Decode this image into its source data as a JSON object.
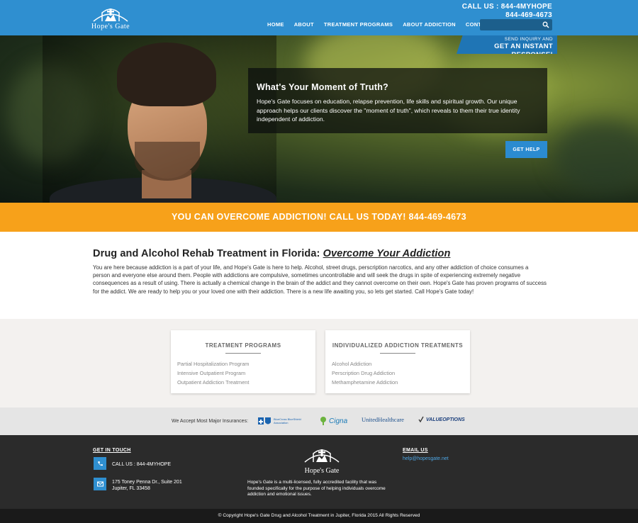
{
  "header": {
    "logo_text": "Hope's Gate",
    "call_line1": "CALL US : 844-4MYHOPE",
    "call_line2": "844-469-4673",
    "nav": [
      "HOME",
      "ABOUT",
      "TREATMENT PROGRAMS",
      "ABOUT ADDICTION",
      "CONTACT"
    ],
    "search_placeholder": "",
    "colors": {
      "brand_blue": "#2f8fd0",
      "orange": "#f7a11a"
    }
  },
  "hero": {
    "inquiry_small": "SEND INQUIRY AND",
    "inquiry_big": "GET AN INSTANT RESPONSE!",
    "box_title": "What's Your Moment of Truth?",
    "box_text": "Hope's Gate focuses on education, relapse prevention, life skills and spiritual growth. Our unique approach helps our clients discover the \"moment of truth\", which reveals to them their true identity independent of addiction.",
    "cta_label": "GET HELP",
    "slide_count": 3,
    "active_slide": 1
  },
  "banner": {
    "text": "YOU CAN OVERCOME ADDICTION! CALL US TODAY! 844-469-4673"
  },
  "intro": {
    "heading": "Drug and Alcohol Rehab Treatment in Florida: ",
    "heading_em": "Overcome Your Addiction",
    "body": "You are here because addiction is a part of your life, and Hope's Gate is here to help. Alcohol, street drugs, perscription narcotics, and any other addiction of choice consumes a person and everyone else around them. People with addictions are compulsive, sometimes uncontrollable and will seek the drugs in spite of experiencing extremely negative consequences as a result of using. There is actually a chemical change in the brain of the addict and they cannot overcome on their own. Hope's Gate has proven programs of success for the addict. We are ready to help you or your loved one with their addiction. There is a new life awaiting you, so lets get started. Call Hope's Gate today!"
  },
  "cards": [
    {
      "title": "TREATMENT PROGRAMS",
      "items": [
        "Partial Hospitalization Program",
        "Intensive Outpatient Program",
        "Outpatient Addiction Treatment"
      ]
    },
    {
      "title": "INDIVIDUALIZED ADDICTION TREATMENTS",
      "items": [
        "Alcohol Addiction",
        "Perscription Drug Addiction",
        "Methamphetamine Addiction"
      ]
    }
  ],
  "insurance": {
    "label": "We Accept Most Major Insurances:",
    "providers": [
      {
        "name": "BlueCross BlueShield Association",
        "icon": "bcbs-logo"
      },
      {
        "name": "Cigna",
        "icon": "cigna-logo"
      },
      {
        "name": "UnitedHealthcare",
        "icon": "unitedhealthcare-logo"
      },
      {
        "name": "VALUEOPTIONS",
        "icon": "valueoptions-logo"
      }
    ]
  },
  "footer": {
    "get_in_touch": "GET IN TOUCH",
    "phone": "CALL US : 844-4MYHOPE",
    "address_line1": "175 Toney Penna Dr., Suite 201",
    "address_line2": "Jupiter, FL 33458",
    "logo_text": "Hope's Gate",
    "description": "Hope's Gate is a multi-licensed, fully accredited facility that was founded specifically for the purpose of helping individuals overcome addiction and emotional issues.",
    "email_title": "EMAIL US",
    "email": "help@hopesgate.net",
    "copyright": "© Copyright Hope's Gate Drug and Alcohol Treatment in Jupiter, Florida 2015 All Rights Reserved"
  }
}
